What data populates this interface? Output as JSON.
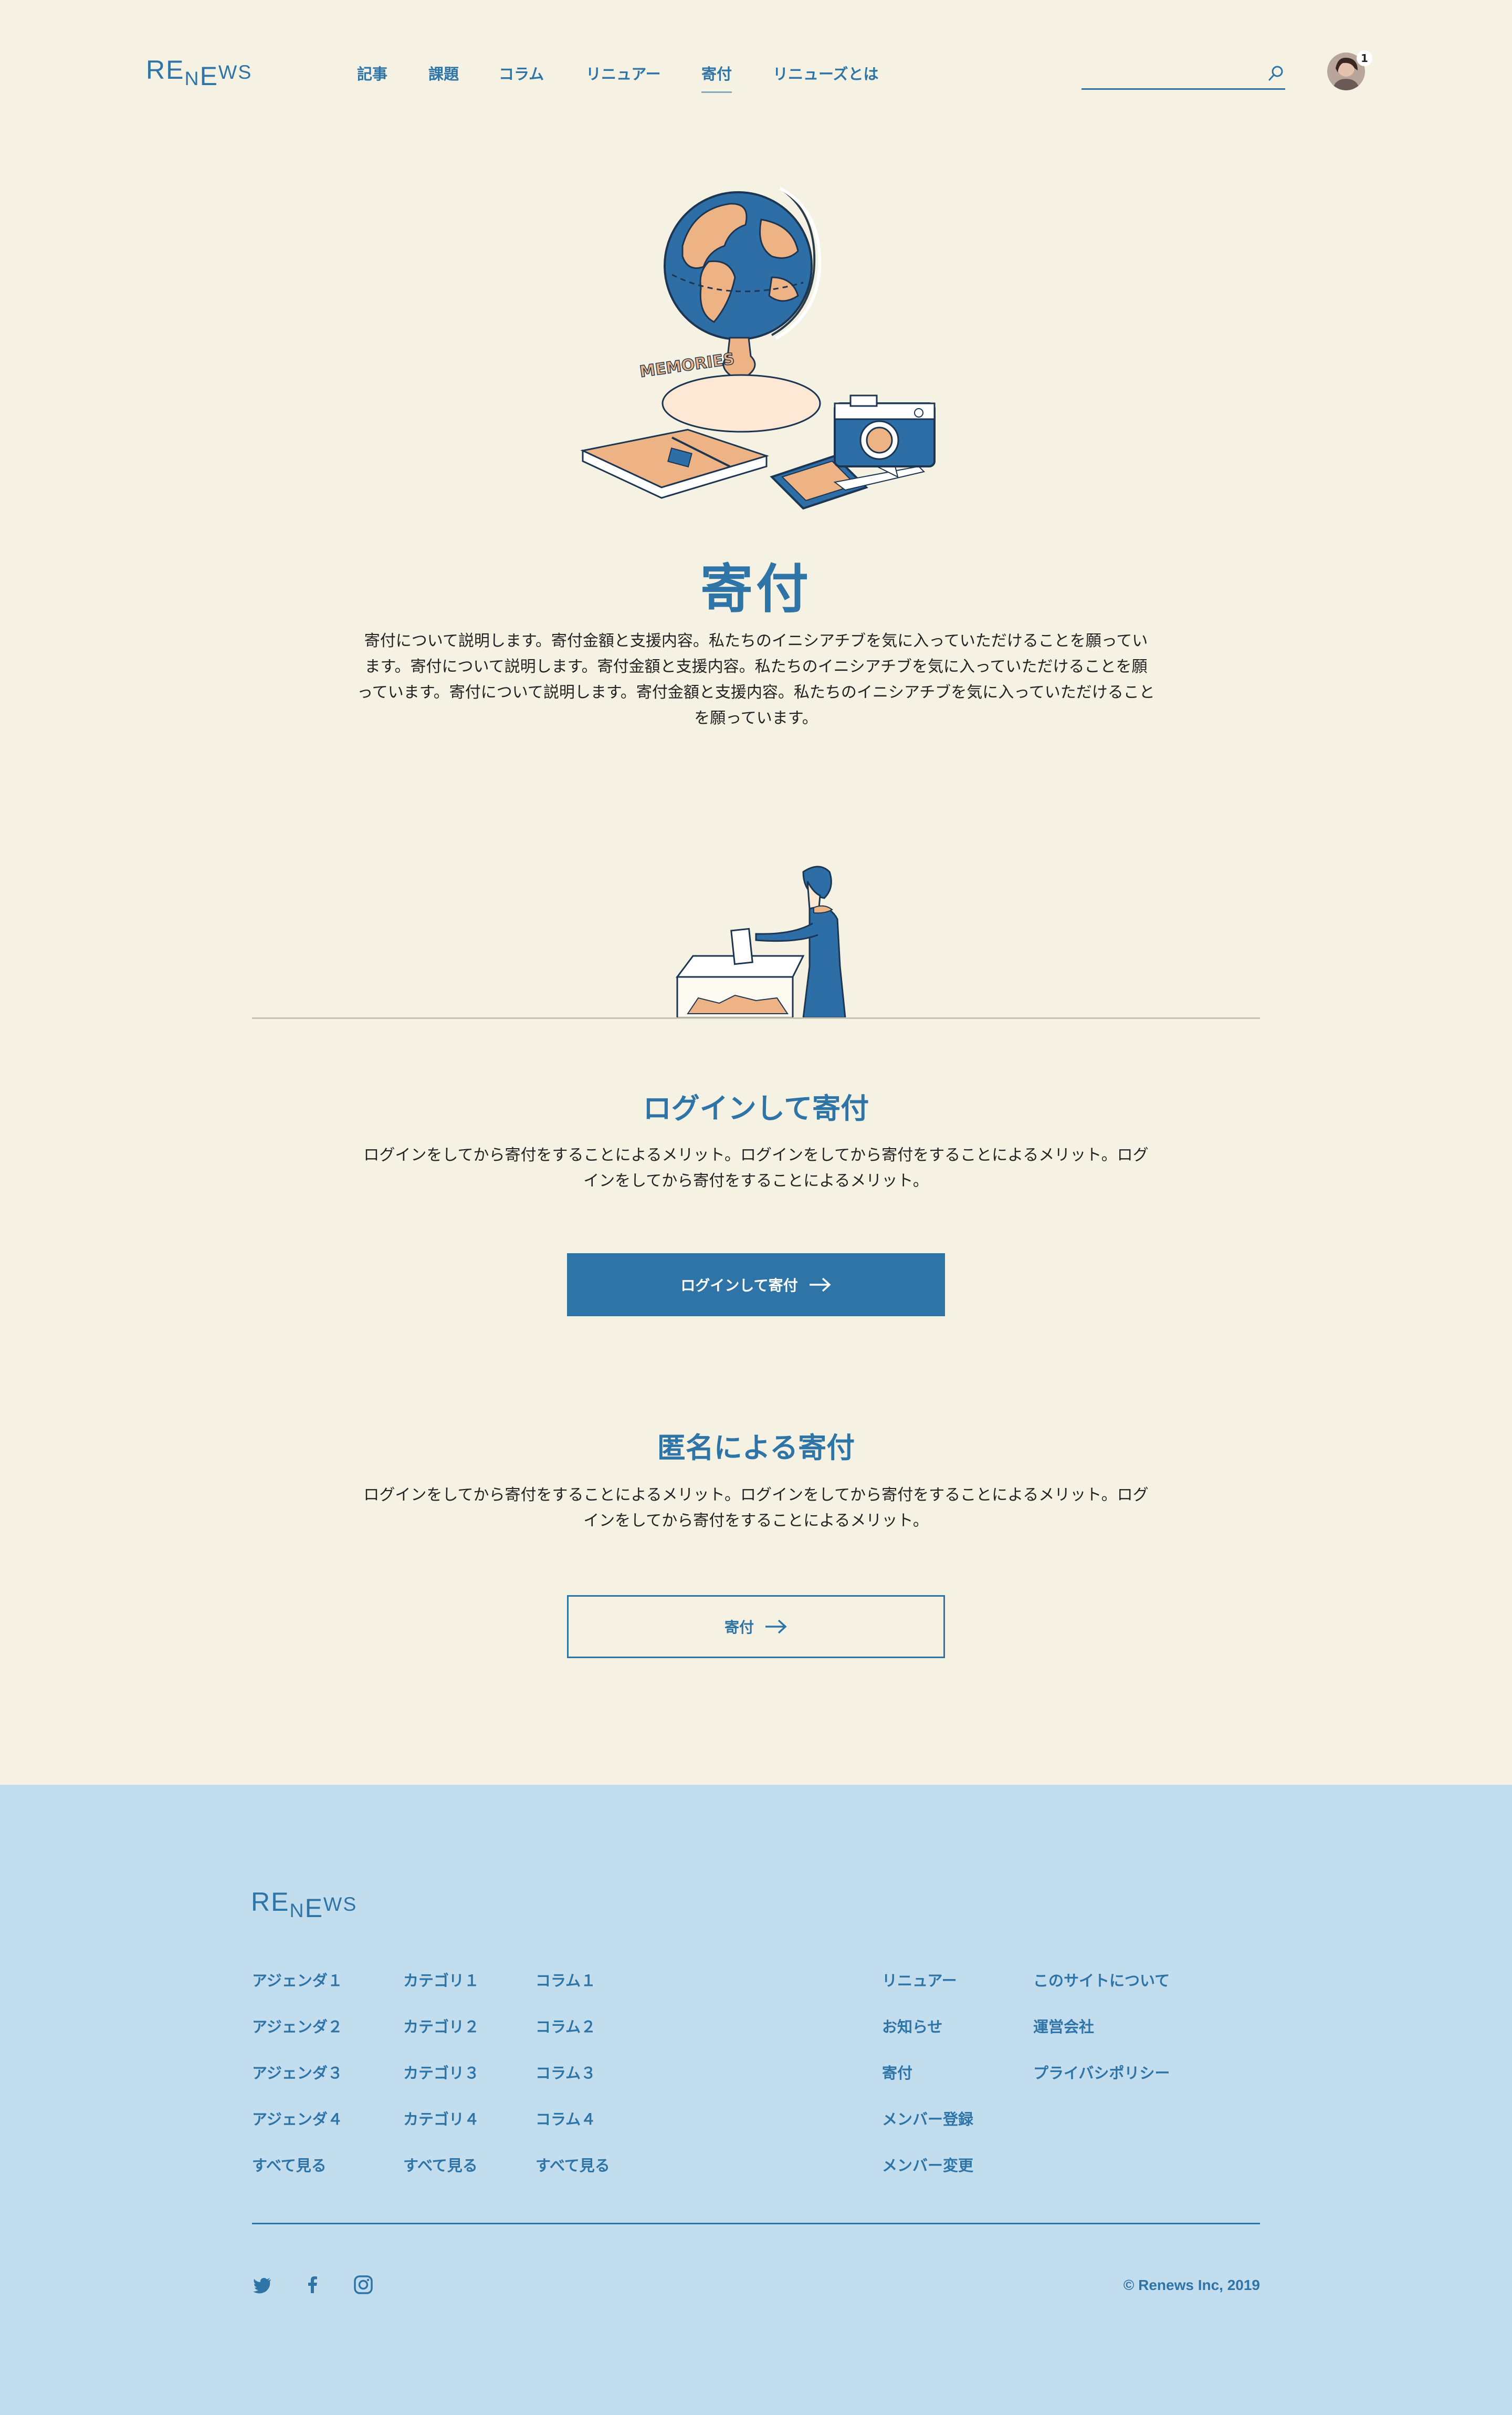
{
  "header": {
    "logo": "RENEWS",
    "nav": [
      "記事",
      "課題",
      "コラム",
      "リニュアー",
      "寄付",
      "リニューズとは"
    ],
    "search_placeholder": "",
    "notification_count": "1"
  },
  "hero": {
    "illustration_text": "MEMORIES",
    "title": "寄付",
    "intro": "寄付について説明します。寄付金額と支援内容。私たちのイニシアチブを気に入っていただけることを願っています。寄付について説明します。寄付金額と支援内容。私たちのイニシアチブを気に入っていただけることを願っています。寄付について説明します。寄付金額と支援内容。私たちのイニシアチブを気に入っていただけることを願っています。"
  },
  "login_section": {
    "title": "ログインして寄付",
    "text": "ログインをしてから寄付をすることによるメリット。ログインをしてから寄付をすることによるメリット。ログインをしてから寄付をすることによるメリット。",
    "button": "ログインして寄付"
  },
  "anon_section": {
    "title": "匿名による寄付",
    "text": "ログインをしてから寄付をすることによるメリット。ログインをしてから寄付をすることによるメリット。ログインをしてから寄付をすることによるメリット。",
    "button": "寄付"
  },
  "footer": {
    "logo": "RENEWS",
    "columns": [
      [
        "アジェンダ１",
        "アジェンダ２",
        "アジェンダ３",
        "アジェンダ４",
        "すべて見る"
      ],
      [
        "カテゴリ１",
        "カテゴリ２",
        "カテゴリ３",
        "カテゴリ４",
        "すべて見る"
      ],
      [
        "コラム１",
        "コラム２",
        "コラム３",
        "コラム４",
        "すべて見る"
      ],
      [
        "リニュアー",
        "お知らせ",
        "寄付",
        "メンバー登録",
        "メンバー変更"
      ],
      [
        "このサイトについて",
        "運営会社",
        "プライバシポリシー"
      ]
    ],
    "social": [
      "twitter-icon",
      "facebook-icon",
      "instagram-icon"
    ],
    "copyright": "© Renews Inc, 2019"
  },
  "colors": {
    "background": "#f5f1e3",
    "accent": "#2e74a6",
    "footer_bg": "#c2ddee",
    "illustration_peach": "#eeb384"
  }
}
